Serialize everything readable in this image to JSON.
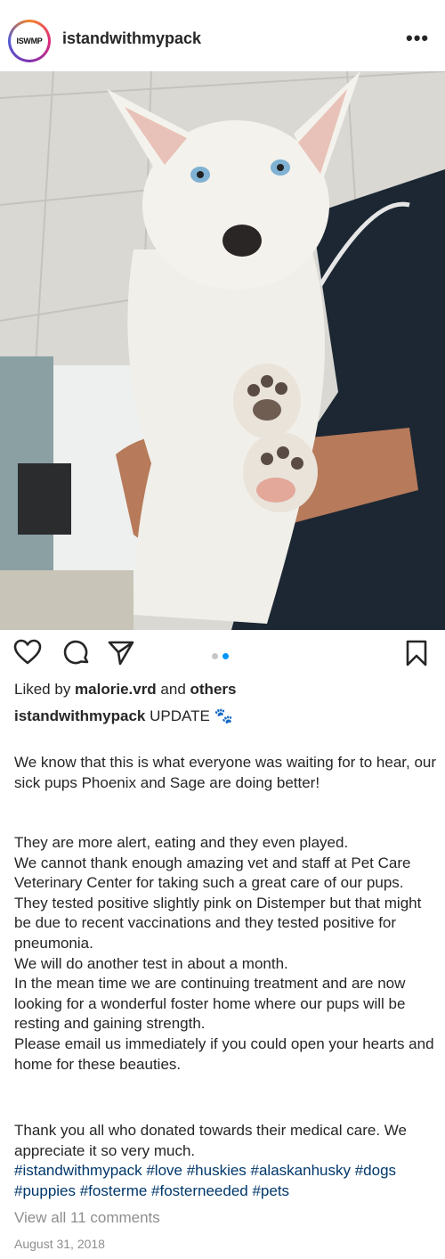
{
  "post": {
    "avatar_text": "ISWMP",
    "username": "istandwithmypack",
    "more_label": "•••"
  },
  "carousel": {
    "slide_count": 2,
    "active_index": 1
  },
  "likes": {
    "prefix": "Liked by ",
    "user": "malorie.vrd",
    "middle": " and ",
    "others": "others"
  },
  "caption": {
    "username": "istandwithmypack",
    "title": " UPDATE 🐾",
    "p1": "We know that this is what everyone was waiting for to hear, our sick pups Phoenix and Sage are doing better!",
    "p2_lines": [
      "They are more alert, eating and they even played.",
      "We cannot thank enough amazing vet and staff at Pet Care Veterinary Center for taking such a great care of our  pups.",
      "They tested positive slightly pink on Distemper but that might be due to recent vaccinations and they tested positive for pneumonia.",
      "We will do another test in about a month.",
      "In the mean time we are continuing treatment and are now looking for a wonderful foster home where our pups will be resting and gaining strength.",
      "Please email us immediately if you could open your hearts and home for these beauties."
    ],
    "p3": "Thank you all who donated towards their medical care. We appreciate it so very much.",
    "hashtags": "#istandwithmypack #love #huskies #alaskanhusky #dogs #puppies #fosterme #fosterneeded #pets"
  },
  "comments_link": "View all 11 comments",
  "date": "August 31, 2018",
  "colors": {
    "link": "#00376b",
    "muted": "#8e8e8e",
    "active_dot": "#0095f6",
    "inactive_dot": "#c7c7c7"
  }
}
